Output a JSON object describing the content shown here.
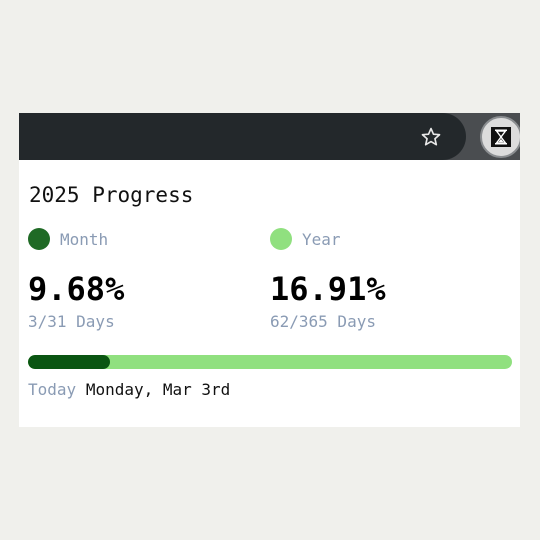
{
  "colors": {
    "month": "#1f6a25",
    "year": "#90e07f",
    "bar_fill": "#0a5512",
    "bar_track": "#90e07f"
  },
  "toolbar": {
    "bookmark_icon": "star-outline-icon",
    "extension_icon": "hourglass-icon"
  },
  "popup": {
    "title": "2025 Progress",
    "month": {
      "label": "Month",
      "percent": "9.68%",
      "days": "3/31 Days"
    },
    "year": {
      "label": "Year",
      "percent": "16.91%",
      "days": "62/365 Days"
    },
    "progress_fraction": 0.1691,
    "today": {
      "label": "Today",
      "value": "Monday, Mar 3rd"
    }
  }
}
